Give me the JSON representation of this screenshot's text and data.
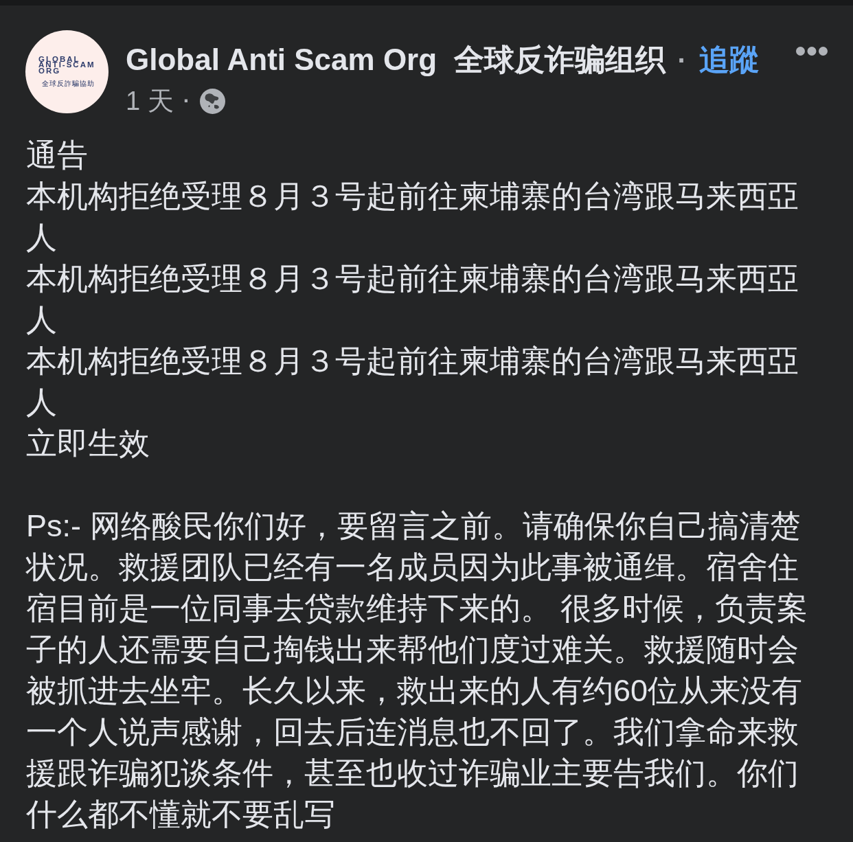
{
  "post_header": {
    "avatar": {
      "logo_lines": [
        "GLOBAL",
        "ANTI-SCAM",
        "ORG"
      ],
      "logo_subtitle": "全球反詐騙協助"
    },
    "page_name": "Global Anti Scam Org  全球反诈骗组织",
    "separator": "·",
    "follow_link": "追蹤",
    "timestamp": "1 天",
    "meta_separator": "·"
  },
  "post_body": {
    "notice": {
      "title": "通告",
      "lines": [
        "本机构拒绝受理８月３号起前往柬埔寨的台湾跟马来西亞人",
        "本机构拒绝受理８月３号起前往柬埔寨的台湾跟马来西亞人",
        "本机构拒绝受理８月３号起前往柬埔寨的台湾跟马来西亞人"
      ],
      "effective": "立即生效"
    },
    "postscript": "Ps:- 网络酸民你们好，要留言之前。请确保你自己搞清楚状况。救援团队已经有一名成员因为此事被通缉。宿舍住宿目前是一位同事去贷款维持下来的。 很多时候，负责案子的人还需要自己掏钱出来帮他们度过难关。救援随时会被抓进去坐牢。长久以来，救出来的人有约60位从来没有一个人说声感谢，回去后连消息也不回了。我们拿命来救援跟诈骗犯谈条件，甚至也收过诈骗业主要告我们。你们什么都不懂就不要乱写"
  }
}
